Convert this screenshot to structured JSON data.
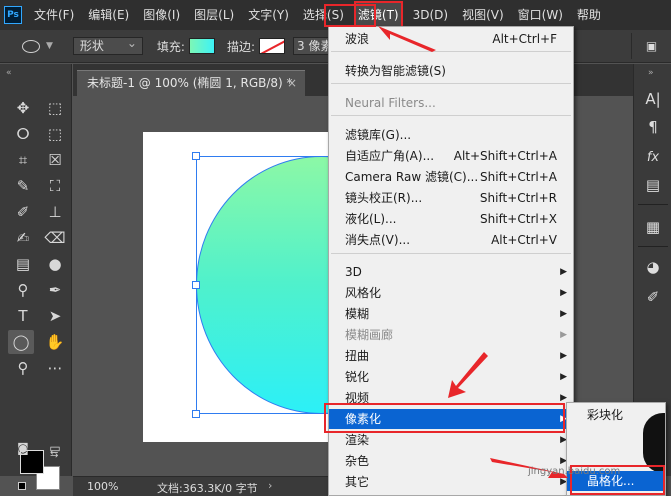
{
  "app": {
    "logo_text": "Ps"
  },
  "menubar": {
    "items": [
      "文件(F)",
      "编辑(E)",
      "图像(I)",
      "图层(L)",
      "文字(Y)",
      "选择(S)",
      "滤镜(T)",
      "3D(D)",
      "视图(V)",
      "窗口(W)",
      "帮助"
    ],
    "active_index": 6
  },
  "options": {
    "mode": "形状",
    "fill_label": "填充:",
    "stroke_label": "描边:",
    "stroke_width": "3 像素",
    "fill_colors": [
      "#7df7b6",
      "#3df2f6"
    ],
    "stroke_color": "#e8262a"
  },
  "document": {
    "tab_title": "未标题-1 @ 100% (椭圆 1, RGB/8) *",
    "close": "×"
  },
  "status": {
    "zoom": "100%",
    "info": "文档:363.3K/0 字节",
    "arrow": "›"
  },
  "filter_menu": {
    "items": [
      {
        "label": "波浪",
        "shortcut": "Alt+Ctrl+F"
      },
      {
        "label": "转换为智能滤镜(S)"
      },
      {
        "label": "Neural Filters...",
        "disabled": true
      },
      {
        "label": "滤镜库(G)..."
      },
      {
        "label": "自适应广角(A)...",
        "shortcut": "Alt+Shift+Ctrl+A"
      },
      {
        "label": "Camera Raw 滤镜(C)...",
        "shortcut": "Shift+Ctrl+A"
      },
      {
        "label": "镜头校正(R)...",
        "shortcut": "Shift+Ctrl+R"
      },
      {
        "label": "液化(L)...",
        "shortcut": "Shift+Ctrl+X"
      },
      {
        "label": "消失点(V)...",
        "shortcut": "Alt+Ctrl+V"
      },
      {
        "label": "3D",
        "submenu": true
      },
      {
        "label": "风格化",
        "submenu": true
      },
      {
        "label": "模糊",
        "submenu": true
      },
      {
        "label": "模糊画廊",
        "submenu": true,
        "disabled": true
      },
      {
        "label": "扭曲",
        "submenu": true
      },
      {
        "label": "锐化",
        "submenu": true
      },
      {
        "label": "视频",
        "submenu": true
      },
      {
        "label": "像素化",
        "submenu": true,
        "highlighted": true
      },
      {
        "label": "渲染",
        "submenu": true
      },
      {
        "label": "杂色",
        "submenu": true
      },
      {
        "label": "其它",
        "submenu": true
      }
    ],
    "submenu_arrow": "▶"
  },
  "pixelate_submenu": {
    "items": [
      {
        "label": "彩块化"
      },
      {
        "label": ""
      },
      {
        "label": ""
      },
      {
        "label": "晶格化...",
        "highlighted": true
      }
    ]
  },
  "watermark": "jingyan.baidu.com",
  "icons": {
    "toolbar": [
      "move-icon",
      "marquee-icon",
      "lasso-icon",
      "object-select-icon",
      "crop-icon",
      "frame-icon",
      "eyedropper-icon",
      "spot-heal-icon",
      "brush-icon",
      "stamp-icon",
      "history-brush-icon",
      "eraser-icon",
      "gradient-icon",
      "blur-icon",
      "dodge-icon",
      "pen-icon",
      "type-icon",
      "path-select-icon",
      "ellipse-icon",
      "hand-icon",
      "zoom-icon",
      "more-icon"
    ],
    "right_panel": [
      "character-icon",
      "paragraph-icon",
      "fx-icon",
      "book-icon",
      "grid-icon",
      "palette-icon",
      "brush-settings-icon"
    ]
  },
  "colors": {
    "accent_highlight": "#0a64d2",
    "annotation_red": "#e8262a",
    "foreground": "#000000",
    "background": "#ffffff"
  }
}
